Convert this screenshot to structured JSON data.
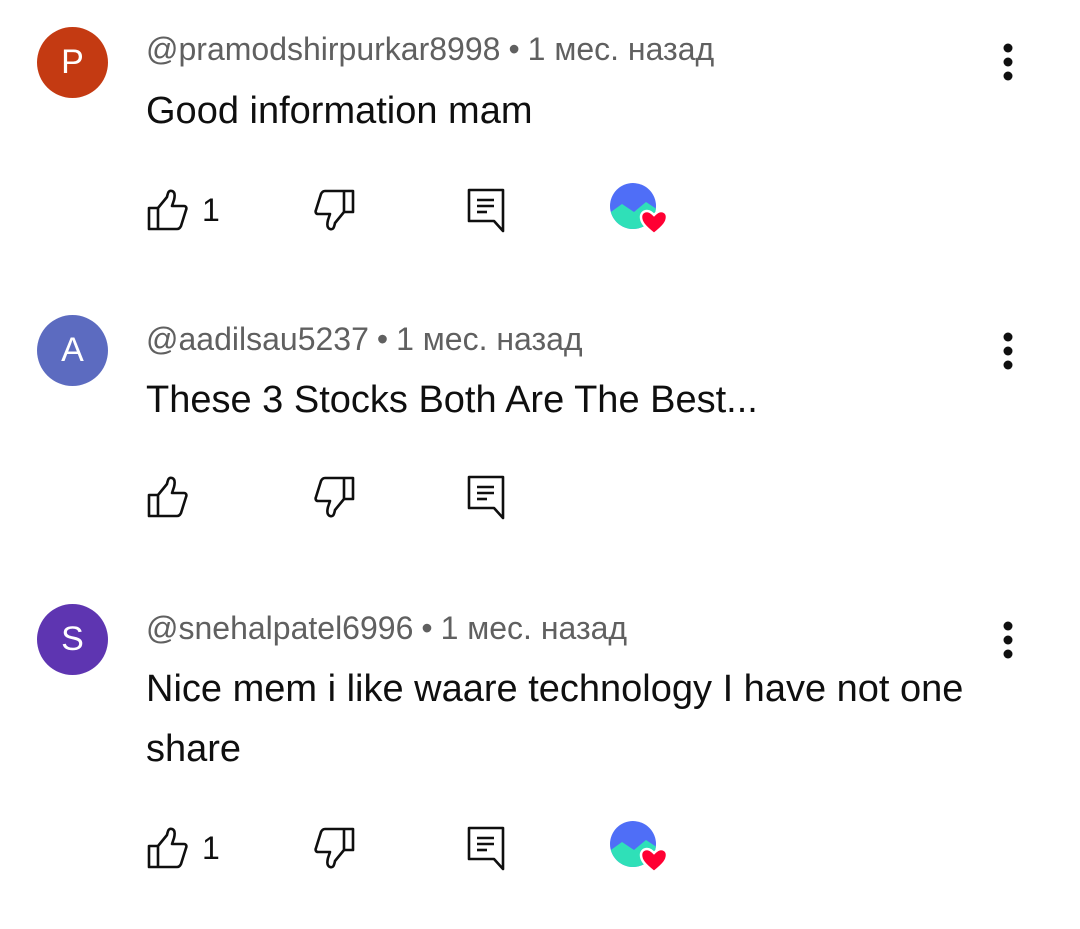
{
  "comments": [
    {
      "avatar_letter": "P",
      "avatar_color": "#c43a12",
      "author": "@pramodshirpurkar8998",
      "separator": "•",
      "time": "1 мес. назад",
      "text": "Good information mam",
      "likes": "1",
      "creator_hearted": true
    },
    {
      "avatar_letter": "A",
      "avatar_color": "#5c6bc0",
      "author": "@aadilsau5237",
      "separator": "•",
      "time": "1 мес. назад",
      "text": "These 3 Stocks Both Are The Best...",
      "likes": "",
      "creator_hearted": false
    },
    {
      "avatar_letter": "S",
      "avatar_color": "#5e35b1",
      "author": "@snehalpatel6996",
      "separator": "•",
      "time": "1 мес. назад",
      "text": "Nice mem i like waare technology I have not one share",
      "likes": "1",
      "creator_hearted": true
    }
  ],
  "icons": {
    "like": "thumb-up-icon",
    "dislike": "thumb-down-icon",
    "reply": "comment-reply-icon",
    "menu": "more-vert-icon",
    "heart": "creator-heart-icon"
  },
  "colors": {
    "heart": "#ff0033",
    "creator_avatar_blue": "#4f6ef7",
    "creator_avatar_teal": "#2fe0b8"
  }
}
